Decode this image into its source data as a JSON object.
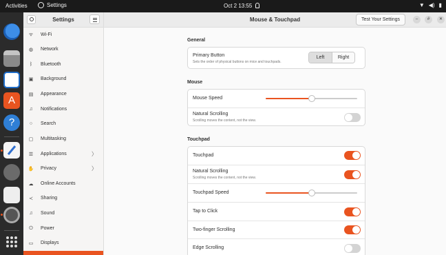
{
  "topbar": {
    "activities": "Activities",
    "app_name": "Settings",
    "clock": "Oct 2  13:55",
    "sys_icons": [
      "network-icon",
      "volume-icon",
      "battery-icon"
    ]
  },
  "dock": {
    "apps": [
      "thunderbird-icon",
      "files-icon",
      "writer-icon",
      "software-icon",
      "help-icon",
      "text-editor-icon",
      "gimp-icon",
      "screenshot-icon",
      "settings-icon",
      "show-apps-icon"
    ]
  },
  "sidebar": {
    "title": "Settings",
    "items": [
      {
        "label": "Wi-Fi",
        "icon": "wifi-icon"
      },
      {
        "label": "Network",
        "icon": "network-icon"
      },
      {
        "label": "Bluetooth",
        "icon": "bluetooth-icon"
      },
      {
        "label": "Background",
        "icon": "background-icon"
      },
      {
        "label": "Appearance",
        "icon": "appearance-icon"
      },
      {
        "label": "Notifications",
        "icon": "bell-icon"
      },
      {
        "label": "Search",
        "icon": "search-icon"
      },
      {
        "label": "Multitasking",
        "icon": "multitasking-icon"
      },
      {
        "label": "Applications",
        "icon": "applications-icon",
        "chevron": "〉"
      },
      {
        "label": "Privacy",
        "icon": "privacy-icon",
        "chevron": "〉"
      },
      {
        "label": "Online Accounts",
        "icon": "cloud-icon"
      },
      {
        "label": "Sharing",
        "icon": "share-icon"
      },
      {
        "label": "Sound",
        "icon": "music-note-icon"
      },
      {
        "label": "Power",
        "icon": "power-icon"
      },
      {
        "label": "Displays",
        "icon": "display-icon"
      }
    ]
  },
  "header": {
    "title": "Mouse & Touchpad",
    "test_button": "Test Your Settings"
  },
  "general": {
    "title": "General",
    "primary_button": {
      "label": "Primary Button",
      "sub": "Sets the order of physical buttons on mice and touchpads.",
      "left": "Left",
      "right": "Right",
      "selected": "Left"
    }
  },
  "mouse": {
    "title": "Mouse",
    "speed_label": "Mouse Speed",
    "speed_value": 0.5,
    "natural_label": "Natural Scrolling",
    "natural_sub": "Scrolling moves the content, not the view.",
    "natural_on": false
  },
  "touchpad": {
    "title": "Touchpad",
    "touchpad_label": "Touchpad",
    "touchpad_on": true,
    "natural_label": "Natural Scrolling",
    "natural_sub": "Scrolling moves the content, not the view.",
    "natural_on": true,
    "speed_label": "Touchpad Speed",
    "speed_value": 0.5,
    "tap_label": "Tap to Click",
    "tap_on": true,
    "twofinger_label": "Two-finger Scrolling",
    "twofinger_on": true,
    "edge_label": "Edge Scrolling",
    "edge_on": false
  },
  "colors": {
    "accent": "#e95420",
    "topbar": "#1a1a1a",
    "dock": "#2b2b2b"
  }
}
